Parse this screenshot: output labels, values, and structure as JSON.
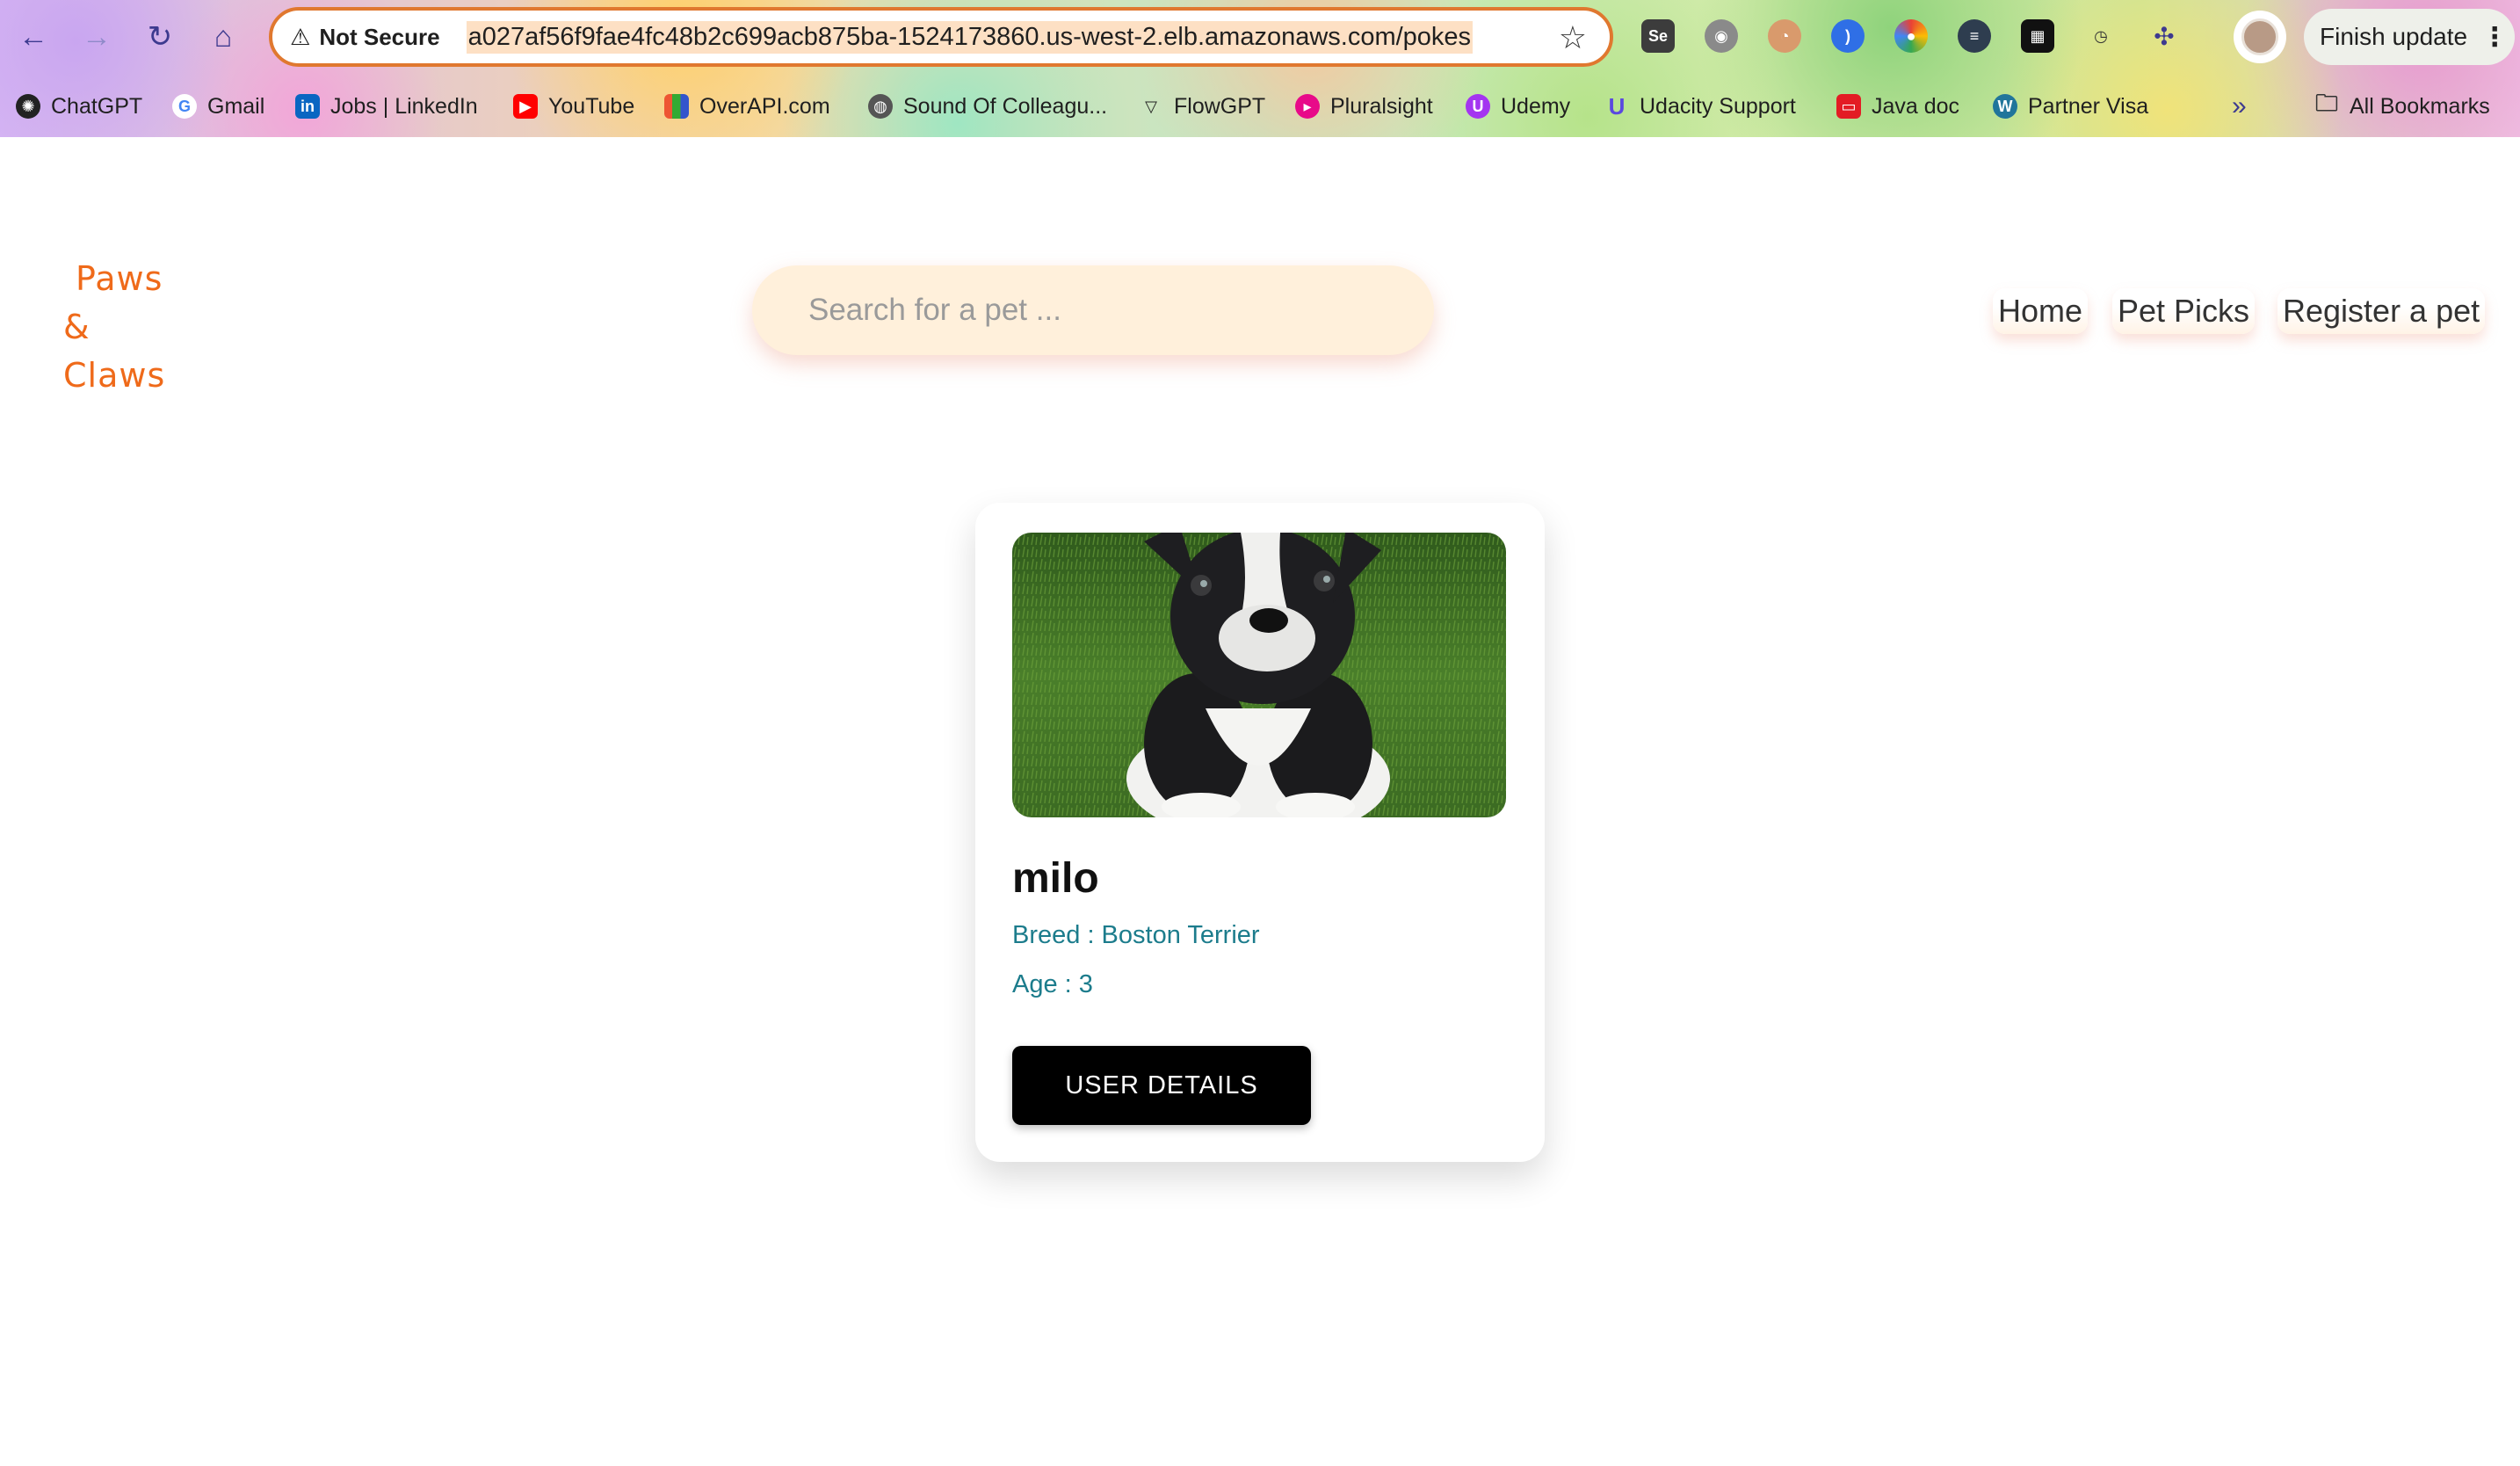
{
  "browser": {
    "security_label": "Not Secure",
    "url": "a027af56f9fae4fc48b2c699acb875ba-1524173860.us-west-2.elb.amazonaws.com/pokes",
    "update_button": "Finish update",
    "extensions": [
      "Se",
      "camera",
      "eyes",
      "wallet",
      "color-circle",
      "chat",
      "grid",
      "timer",
      "puzzle"
    ],
    "bookmarks": [
      {
        "label": "ChatGPT",
        "icon": "chatgpt-icon",
        "color": "#222222"
      },
      {
        "label": "Gmail",
        "icon": "google-icon",
        "color": "#4285f4"
      },
      {
        "label": "Jobs | LinkedIn",
        "icon": "linkedin-icon",
        "color": "#0a66c2"
      },
      {
        "label": "YouTube",
        "icon": "youtube-icon",
        "color": "#ff0000"
      },
      {
        "label": "OverAPI.com",
        "icon": "overapi-icon",
        "color": "#3a7f3a"
      },
      {
        "label": "Sound Of Colleagu...",
        "icon": "globe-icon",
        "color": "#555555"
      },
      {
        "label": "FlowGPT",
        "icon": "flowgpt-icon",
        "color": "#222222"
      },
      {
        "label": "Pluralsight",
        "icon": "pluralsight-icon",
        "color": "#e80a89"
      },
      {
        "label": "Udemy",
        "icon": "udemy-icon",
        "color": "#a435f0"
      },
      {
        "label": "Udacity Support",
        "icon": "udacity-icon",
        "color": "#5a48e0"
      },
      {
        "label": "Java doc",
        "icon": "java-icon",
        "color": "#e31c24"
      },
      {
        "label": "Partner Visa",
        "icon": "wordpress-icon",
        "color": "#21759b"
      }
    ],
    "all_bookmarks": "All Bookmarks"
  },
  "site": {
    "logo_line1": "Paws",
    "logo_line2": "& Claws",
    "brand_color": "#ef6a1a",
    "search_placeholder": "Search for a pet ...",
    "nav": {
      "home": "Home",
      "pet_picks": "Pet Picks",
      "register": "Register a pet"
    }
  },
  "pet": {
    "name": "milo",
    "breed": "Breed : Boston Terrier",
    "age": "Age : 3",
    "button": "USER DETAILS",
    "accent": "#1c7c8c"
  }
}
